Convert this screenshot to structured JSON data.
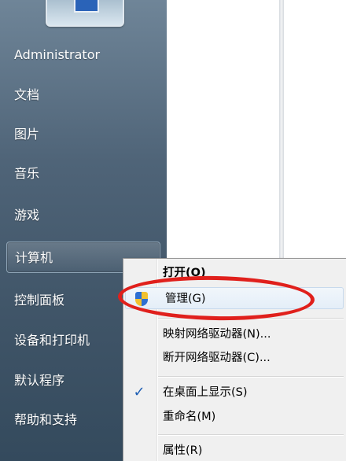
{
  "start_menu": {
    "items": [
      {
        "label": "Administrator"
      },
      {
        "label": "文档"
      },
      {
        "label": "图片"
      },
      {
        "label": "音乐"
      },
      {
        "label": "游戏"
      },
      {
        "label": "计算机",
        "selected": true
      },
      {
        "label": "控制面板"
      },
      {
        "label": "设备和打印机"
      },
      {
        "label": "默认程序"
      },
      {
        "label": "帮助和支持"
      }
    ]
  },
  "context_menu": {
    "items": [
      {
        "label": "打开(O)",
        "bold": true
      },
      {
        "label": "管理(G)",
        "icon": "uac-shield-icon",
        "highlighted": true
      },
      {
        "label": "映射网络驱动器(N)..."
      },
      {
        "label": "断开网络驱动器(C)..."
      },
      {
        "label": "在桌面上显示(S)",
        "icon": "checkmark-icon",
        "checked": true
      },
      {
        "label": "重命名(M)"
      },
      {
        "label": "属性(R)"
      }
    ]
  },
  "annotation": {
    "color": "#e0201c",
    "shape": "ellipse",
    "target": "管理(G)"
  },
  "colors": {
    "menu_bg": "#f0f0f0",
    "highlight": "#e4eef8",
    "pane_dark": "#4f6478"
  }
}
